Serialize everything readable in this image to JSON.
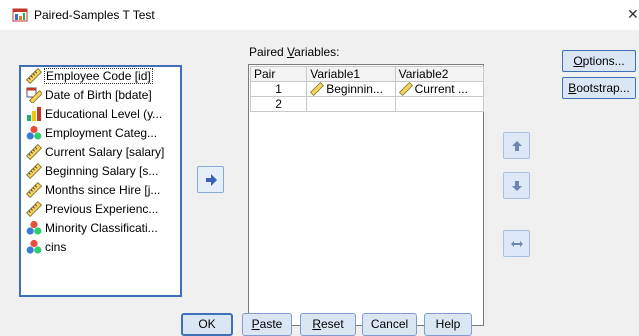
{
  "window": {
    "title": "Paired-Samples T Test",
    "close_glyph": "✕"
  },
  "source_list": {
    "items": [
      {
        "label": "Employee Code [id]",
        "icon": "scale-ruler-icon",
        "selected": true
      },
      {
        "label": "Date of Birth [bdate]",
        "icon": "date-ruler-icon"
      },
      {
        "label": "Educational Level (y...",
        "icon": "bar-chart-icon"
      },
      {
        "label": "Employment Categ...",
        "icon": "nominal-balls-icon"
      },
      {
        "label": "Current Salary [salary]",
        "icon": "scale-ruler-icon"
      },
      {
        "label": "Beginning Salary [s...",
        "icon": "scale-ruler-icon"
      },
      {
        "label": "Months since Hire [j...",
        "icon": "scale-ruler-icon"
      },
      {
        "label": "Previous Experienc...",
        "icon": "scale-ruler-icon"
      },
      {
        "label": "Minority Classificati...",
        "icon": "nominal-balls-icon"
      },
      {
        "label": "cins",
        "icon": "nominal-balls-icon"
      }
    ]
  },
  "paired": {
    "label_pre": "Paired ",
    "label_u": "V",
    "label_post": "ariables:",
    "columns": [
      "Pair",
      "Variable1",
      "Variable2"
    ],
    "rows": [
      {
        "pair": "1",
        "var1": "Beginnin...",
        "var2": "Current ..."
      },
      {
        "pair": "2",
        "var1": "",
        "var2": ""
      }
    ]
  },
  "buttons": {
    "options": {
      "u": "O",
      "rest": "ptions..."
    },
    "bootstrap": {
      "u": "B",
      "rest": "ootstrap..."
    },
    "ok": "OK",
    "paste": {
      "u": "P",
      "rest": "aste"
    },
    "reset": {
      "u": "R",
      "rest": "eset"
    },
    "cancel": "Cancel",
    "help": "Help"
  },
  "colors": {
    "accent": "#3f6fb8",
    "button_bg": "#dbe6f5",
    "dialog_bg": "#f0f0f0"
  }
}
